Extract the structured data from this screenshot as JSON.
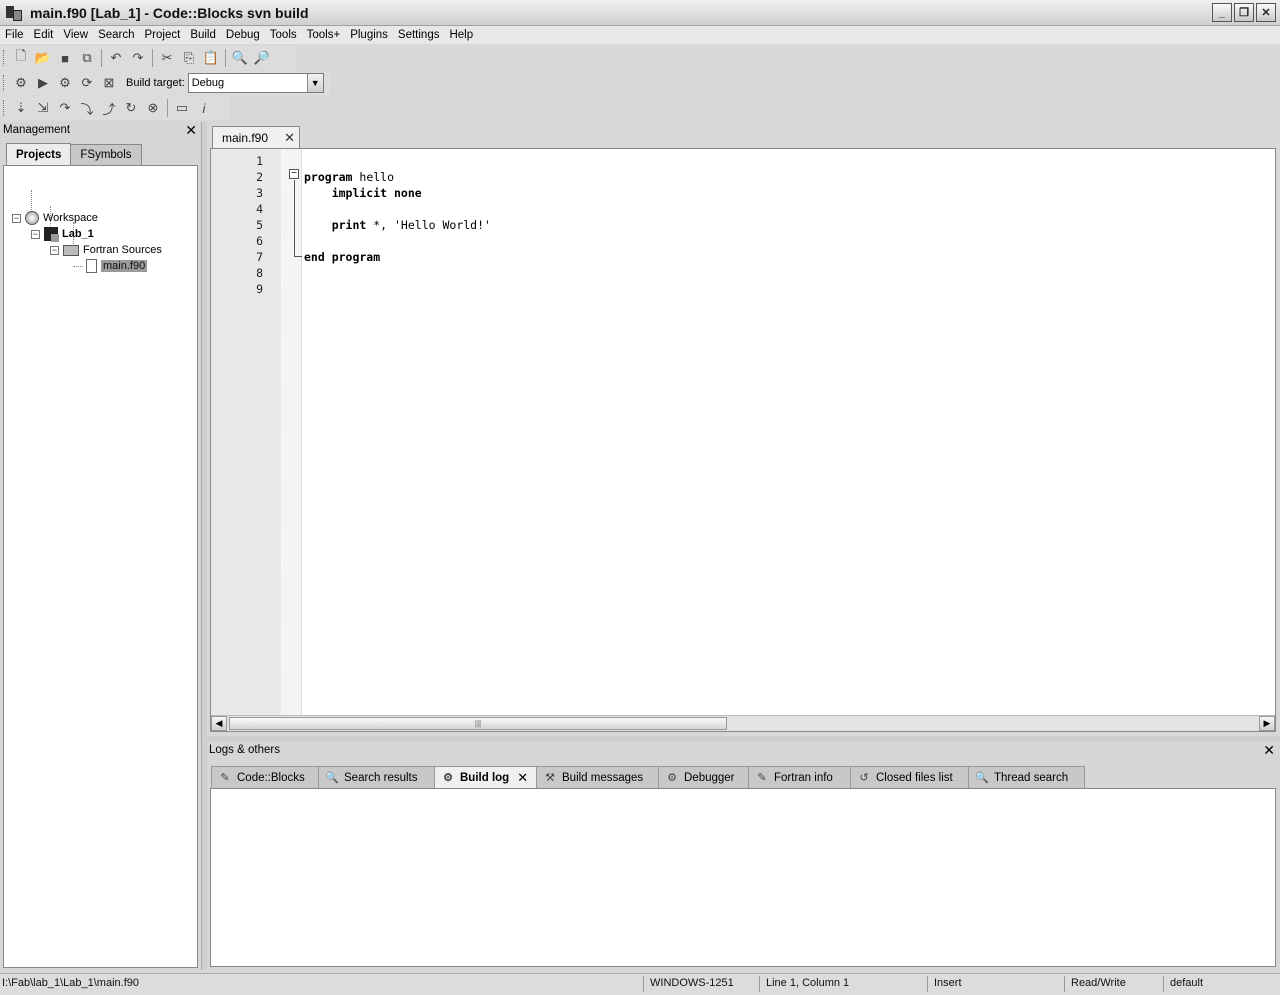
{
  "window": {
    "title": "main.f90 [Lab_1] - Code::Blocks svn build"
  },
  "menu": [
    "File",
    "Edit",
    "View",
    "Search",
    "Project",
    "Build",
    "Debug",
    "Tools",
    "Tools+",
    "Plugins",
    "Settings",
    "Help"
  ],
  "toolbar": {
    "build_target_label": "Build target:",
    "build_target_value": "Debug"
  },
  "management": {
    "title": "Management",
    "tabs": [
      "Projects",
      "FSymbols"
    ],
    "tree": {
      "workspace": "Workspace",
      "project": "Lab_1",
      "folder": "Fortran Sources",
      "file": "main.f90"
    }
  },
  "editor": {
    "tab": "main.f90",
    "line_numbers": [
      "1",
      "2",
      "3",
      "4",
      "5",
      "6",
      "7",
      "8",
      "9"
    ],
    "lines": [
      {
        "kw": "",
        "rest": ""
      },
      {
        "kw": "program",
        "rest": " hello"
      },
      {
        "kw": "    implicit none",
        "rest": ""
      },
      {
        "kw": "",
        "rest": ""
      },
      {
        "kw": "    print",
        "rest": " *, 'Hello World!'"
      },
      {
        "kw": "",
        "rest": ""
      },
      {
        "kw": "end program",
        "rest": ""
      },
      {
        "kw": "",
        "rest": ""
      },
      {
        "kw": "",
        "rest": ""
      }
    ]
  },
  "logs": {
    "title": "Logs & others",
    "tabs": [
      "Code::Blocks",
      "Search results",
      "Build log",
      "Build messages",
      "Debugger",
      "Fortran info",
      "Closed files list",
      "Thread search"
    ],
    "active_tab": "Build log"
  },
  "status": {
    "path": "I:\\Fab\\lab_1\\Lab_1\\main.f90",
    "encoding": "WINDOWS-1251",
    "position": "Line 1, Column 1",
    "mode": "Insert",
    "access": "Read/Write",
    "lang": "default"
  },
  "icons": [
    "app-icon",
    "new-file-icon",
    "open-icon",
    "save-icon",
    "save-all-icon",
    "undo-icon",
    "redo-icon",
    "cut-icon",
    "copy-icon",
    "paste-icon",
    "find-icon",
    "replace-icon",
    "build-icon",
    "run-icon",
    "build-run-icon",
    "rebuild-icon",
    "abort-icon",
    "debug-icon",
    "run-to-cursor-icon",
    "next-line-icon",
    "step-into-icon",
    "step-out-icon",
    "next-instruction-icon",
    "stop-debugger-icon",
    "debug-windows-icon",
    "info-icon"
  ]
}
